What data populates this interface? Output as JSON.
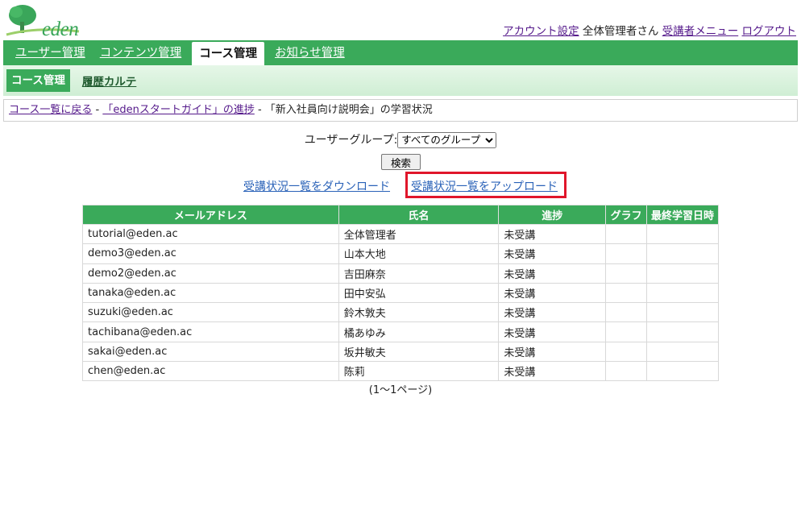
{
  "logo": {
    "text": "eden",
    "icon": "tree-logo-icon"
  },
  "topnav": {
    "account_settings": "アカウント設定",
    "user_name": "全体管理者さん",
    "learner_menu": "受講者メニュー",
    "logout": "ログアウト"
  },
  "mainnav": {
    "tabs": [
      {
        "label": "ユーザー管理"
      },
      {
        "label": "コンテンツ管理"
      },
      {
        "label": "コース管理",
        "active": true
      },
      {
        "label": "お知らせ管理"
      }
    ]
  },
  "subnav": {
    "active": "コース管理",
    "history": "履歴カルテ"
  },
  "breadcrumb": {
    "back": "コース一覧に戻る",
    "sep1": " - ",
    "progress": "「edenスタートガイド」の進捗",
    "sep2": " - ",
    "current": "「新入社員向け説明会」の学習状況"
  },
  "filter": {
    "label": "ユーザーグループ:",
    "selected": "すべてのグループ",
    "search_button": "検索"
  },
  "links": {
    "download": "受講状況一覧をダウンロード",
    "upload": "受講状況一覧をアップロード"
  },
  "table": {
    "headers": [
      "メールアドレス",
      "氏名",
      "進捗",
      "グラフ",
      "最終学習日時"
    ],
    "rows": [
      [
        "tutorial@eden.ac",
        "全体管理者",
        "未受講",
        "",
        ""
      ],
      [
        "demo3@eden.ac",
        "山本大地",
        "未受講",
        "",
        ""
      ],
      [
        "demo2@eden.ac",
        "吉田麻奈",
        "未受講",
        "",
        ""
      ],
      [
        "tanaka@eden.ac",
        "田中安弘",
        "未受講",
        "",
        ""
      ],
      [
        "suzuki@eden.ac",
        "鈴木敦夫",
        "未受講",
        "",
        ""
      ],
      [
        "tachibana@eden.ac",
        "橘あゆみ",
        "未受講",
        "",
        ""
      ],
      [
        "sakai@eden.ac",
        "坂井敏夫",
        "未受講",
        "",
        ""
      ],
      [
        "chen@eden.ac",
        "陈莉",
        "未受講",
        "",
        ""
      ]
    ]
  },
  "pager": "(1〜1ページ)",
  "colors": {
    "brand_green": "#3aaa5a",
    "highlight_red": "#e0162b",
    "link_blue": "#2a62b8"
  }
}
